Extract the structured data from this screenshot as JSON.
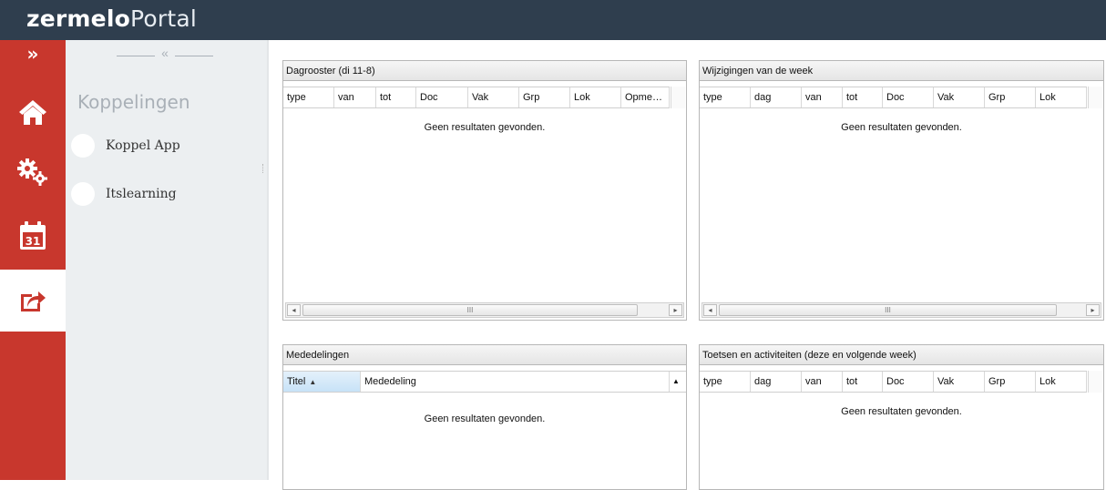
{
  "app": {
    "brand_bold": "zermelo",
    "brand_light": "Portal"
  },
  "nav": {
    "expand_label": "»",
    "items": [
      {
        "icon": "home-icon"
      },
      {
        "icon": "gears-icon"
      },
      {
        "icon": "calendar-icon",
        "calendar_day": "31"
      },
      {
        "icon": "share-icon",
        "active": true
      }
    ]
  },
  "subnav": {
    "collapse_label": "«",
    "title": "Koppelingen",
    "links": [
      {
        "label": "Koppel App"
      },
      {
        "label": "Itslearning"
      }
    ]
  },
  "panels": {
    "dagrooster": {
      "title": "Dagrooster (di 11-8)",
      "columns": [
        "type",
        "van",
        "tot",
        "Doc",
        "Vak",
        "Grp",
        "Lok",
        "Opme…"
      ],
      "empty_text": "Geen resultaten gevonden.",
      "scroll_thumb_label": "III"
    },
    "wijzigingen": {
      "title": "Wijzigingen van de week",
      "columns": [
        "type",
        "dag",
        "van",
        "tot",
        "Doc",
        "Vak",
        "Grp",
        "Lok"
      ],
      "empty_text": "Geen resultaten gevonden.",
      "scroll_thumb_label": "III"
    },
    "mededelingen": {
      "title": "Mededelingen",
      "columns": [
        "Titel",
        "Mededeling"
      ],
      "sorted_column": "Titel",
      "empty_text": "Geen resultaten gevonden."
    },
    "toetsen": {
      "title": "Toetsen en activiteiten (deze en volgende week)",
      "columns": [
        "type",
        "dag",
        "van",
        "tot",
        "Doc",
        "Vak",
        "Grp",
        "Lok"
      ],
      "empty_text": "Geen resultaten gevonden."
    }
  },
  "colors": {
    "header": "#2f3e4e",
    "nav_red": "#c8372d",
    "subnav_bg": "#eceff1"
  }
}
